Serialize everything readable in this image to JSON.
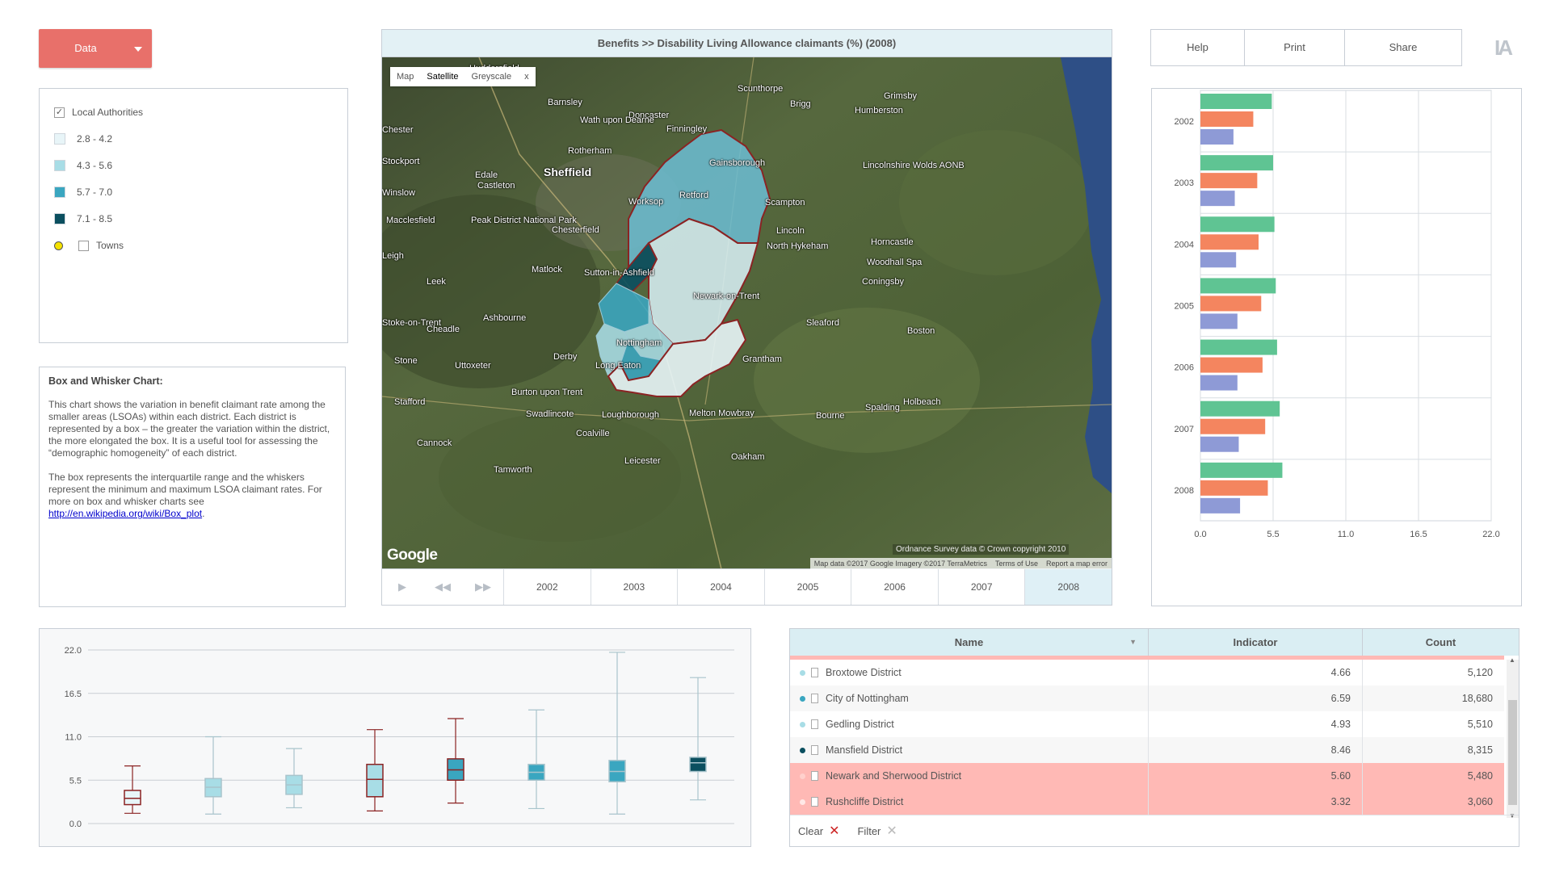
{
  "data_button": {
    "label": "Data"
  },
  "legend": {
    "local_authorities": "Local Authorities",
    "classes": [
      {
        "label": "2.8 - 4.2",
        "color": "#e8f5f8"
      },
      {
        "label": "4.3 - 5.6",
        "color": "#a8dde6"
      },
      {
        "label": "5.7 - 7.0",
        "color": "#3aa6c0"
      },
      {
        "label": "7.1 - 8.5",
        "color": "#0b4f5f"
      }
    ],
    "towns": "Towns"
  },
  "info": {
    "heading": "Box and Whisker Chart:",
    "para1": "This chart shows the variation in benefit claimant rate among the smaller areas (LSOAs) within each district. Each district is represented by a box – the greater the variation within the district, the more elongated the box. It is a useful tool for assessing the “demographic homogeneity” of each district.",
    "para2": "The box represents the interquartile range and the whiskers represent the minimum and maximum LSOA claimant rates. For more on box and whisker charts see",
    "link": "http://en.wikipedia.org/wiki/Box_plot",
    "link_suffix": "."
  },
  "map": {
    "title": "Benefits >>  Disability Living Allowance claimants (%) (2008)",
    "types": [
      "Map",
      "Satellite",
      "Greyscale",
      "x"
    ],
    "google": "Google",
    "os_note": "Ordnance Survey data © Crown copyright 2010",
    "attribution": [
      "Map data ©2017 Google Imagery ©2017 TerraMetrics",
      "Terms of Use",
      "Report a map error"
    ],
    "places": [
      {
        "name": "Huddersfield"
      },
      {
        "name": "Barnsley"
      },
      {
        "name": "Doncaster"
      },
      {
        "name": "Scunthorpe"
      },
      {
        "name": "Grimsby"
      },
      {
        "name": "Brigg"
      },
      {
        "name": "Humberston"
      },
      {
        "name": "Rotherham"
      },
      {
        "name": "Sheffield"
      },
      {
        "name": "Stockport"
      },
      {
        "name": "Wath upon Dearne"
      },
      {
        "name": "Finningley"
      },
      {
        "name": "Gainsborough"
      },
      {
        "name": "Retford"
      },
      {
        "name": "Worksop"
      },
      {
        "name": "Lincolnshire Wolds AONB"
      },
      {
        "name": "Edale"
      },
      {
        "name": "Castleton"
      },
      {
        "name": "Macclesfield"
      },
      {
        "name": "Peak District National Park"
      },
      {
        "name": "Chesterfield"
      },
      {
        "name": "Lincoln"
      },
      {
        "name": "Horncastle"
      },
      {
        "name": "North Hykeham"
      },
      {
        "name": "Woodhall Spa"
      },
      {
        "name": "Coningsby"
      },
      {
        "name": "Matlock"
      },
      {
        "name": "Sutton-in-Ashfield"
      },
      {
        "name": "Leek"
      },
      {
        "name": "Newark-on-Trent"
      },
      {
        "name": "Ashbourne"
      },
      {
        "name": "Sleaford"
      },
      {
        "name": "Boston"
      },
      {
        "name": "Stoke-on-Trent"
      },
      {
        "name": "Cheadle"
      },
      {
        "name": "Nottingham"
      },
      {
        "name": "Derby"
      },
      {
        "name": "Stone"
      },
      {
        "name": "Uttoxeter"
      },
      {
        "name": "Long Eaton"
      },
      {
        "name": "Grantham"
      },
      {
        "name": "Stafford"
      },
      {
        "name": "Burton upon Trent"
      },
      {
        "name": "Swadlincote"
      },
      {
        "name": "Loughborough"
      },
      {
        "name": "Melton Mowbray"
      },
      {
        "name": "Bourne"
      },
      {
        "name": "Spalding"
      },
      {
        "name": "Holbeach"
      },
      {
        "name": "Cannock"
      },
      {
        "name": "Coalville"
      },
      {
        "name": "Tamworth"
      },
      {
        "name": "Leicester"
      },
      {
        "name": "Oakham"
      },
      {
        "name": "Scampton"
      },
      {
        "name": "Leigh"
      },
      {
        "name": "Chester"
      },
      {
        "name": "Winslow"
      }
    ],
    "timeline": [
      "2002",
      "2003",
      "2004",
      "2005",
      "2006",
      "2007",
      "2008"
    ],
    "active_year": "2008"
  },
  "top_buttons": {
    "help": "Help",
    "print": "Print",
    "share": "Share",
    "logo": "IA"
  },
  "chart_data": [
    {
      "type": "bar",
      "orientation": "horizontal",
      "categories": [
        "2002",
        "2003",
        "2004",
        "2005",
        "2006",
        "2007",
        "2008"
      ],
      "series": [
        {
          "values": [
            5.4,
            5.5,
            5.6,
            5.7,
            5.8,
            6.0,
            6.2
          ],
          "color": "#5fc493"
        },
        {
          "values": [
            4.0,
            4.3,
            4.4,
            4.6,
            4.7,
            4.9,
            5.1
          ],
          "color": "#f4855f"
        },
        {
          "values": [
            2.5,
            2.6,
            2.7,
            2.8,
            2.8,
            2.9,
            3.0
          ],
          "color": "#8e9ad6"
        }
      ],
      "xlim": [
        0,
        22
      ],
      "xticks": [
        "0.0",
        "5.5",
        "11.0",
        "16.5",
        "22.0"
      ],
      "grid": true
    },
    {
      "type": "box",
      "ylim": [
        0,
        22
      ],
      "yticks": [
        "0.0",
        "5.5",
        "11.0",
        "16.5",
        "22.0"
      ],
      "boxes": [
        {
          "min": 1.3,
          "q1": 2.4,
          "median": 3.2,
          "q3": 4.2,
          "max": 7.3,
          "color": "#e8f5f8",
          "edge": "#8b2323"
        },
        {
          "min": 1.2,
          "q1": 3.4,
          "median": 4.6,
          "q3": 5.7,
          "max": 11.0,
          "color": "#a8dde6",
          "edge": "#a8c4cc"
        },
        {
          "min": 2.0,
          "q1": 3.7,
          "median": 4.9,
          "q3": 6.1,
          "max": 9.5,
          "color": "#a8dde6",
          "edge": "#a8c4cc"
        },
        {
          "min": 1.6,
          "q1": 3.4,
          "median": 5.6,
          "q3": 7.5,
          "max": 11.9,
          "color": "#a8dde6",
          "edge": "#8b2323"
        },
        {
          "min": 2.6,
          "q1": 5.5,
          "median": 6.8,
          "q3": 8.2,
          "max": 13.3,
          "color": "#3aa6c0",
          "edge": "#8b2323"
        },
        {
          "min": 1.9,
          "q1": 5.5,
          "median": 6.5,
          "q3": 7.5,
          "max": 14.4,
          "color": "#3aa6c0",
          "edge": "#a8c4cc"
        },
        {
          "min": 1.2,
          "q1": 5.3,
          "median": 6.6,
          "q3": 8.0,
          "max": 21.7,
          "color": "#3aa6c0",
          "edge": "#a8c4cc"
        },
        {
          "min": 3.0,
          "q1": 6.6,
          "median": 7.7,
          "q3": 8.4,
          "max": 18.5,
          "color": "#0b4f5f",
          "edge": "#a8c4cc"
        }
      ]
    }
  ],
  "table": {
    "headers": {
      "name": "Name",
      "indicator": "Indicator",
      "count": "Count"
    },
    "rows": [
      {
        "name": "Broxtowe District",
        "indicator": "4.66",
        "count": "5,120",
        "dot": "#a8dde6"
      },
      {
        "name": "City of Nottingham",
        "indicator": "6.59",
        "count": "18,680",
        "dot": "#3aa6c0"
      },
      {
        "name": "Gedling District",
        "indicator": "4.93",
        "count": "5,510",
        "dot": "#a8dde6"
      },
      {
        "name": "Mansfield District",
        "indicator": "8.46",
        "count": "8,315",
        "dot": "#0b4f5f"
      },
      {
        "name": "Newark and Sherwood District",
        "indicator": "5.60",
        "count": "5,480",
        "dot": "#ffd0cc"
      },
      {
        "name": "Rushcliffe District",
        "indicator": "3.32",
        "count": "3,060",
        "dot": "#ffe8e6"
      }
    ],
    "footer": {
      "clear": "Clear",
      "filter": "Filter"
    }
  }
}
